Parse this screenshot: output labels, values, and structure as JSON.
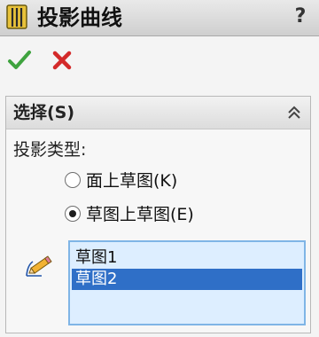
{
  "window": {
    "title": "投影曲线",
    "help_label": "?",
    "title_icon": "curve-feature-icon"
  },
  "actions": {
    "ok_icon": "check-icon",
    "cancel_icon": "close-icon",
    "ok_color": "#3fa33f",
    "cancel_color": "#d32a2a"
  },
  "selection_group": {
    "title": "选择(S)",
    "collapse_icon": "chevron-up-double-icon",
    "projection_type_label": "投影类型:",
    "options": [
      {
        "label": "面上草图(K)",
        "selected": false
      },
      {
        "label": "草图上草图(E)",
        "selected": true
      }
    ],
    "list_icon": "sketch-pencil-icon",
    "list_items": [
      {
        "label": "草图1",
        "selected": false
      },
      {
        "label": "草图2",
        "selected": true
      }
    ],
    "list_highlight_color": "#2f6fc7"
  }
}
